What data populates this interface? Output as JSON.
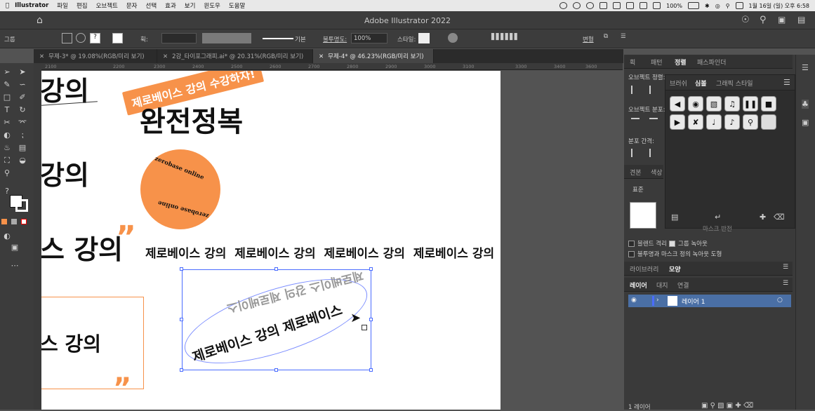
{
  "menubar": {
    "app": "Illustrator",
    "items": [
      "파일",
      "편집",
      "오브젝트",
      "문자",
      "선택",
      "효과",
      "보기",
      "윈도우",
      "도움말"
    ],
    "battery": "100%",
    "clock": "1월 16일 (일) 오후 6:58"
  },
  "titlebar": {
    "title": "Adobe Illustrator 2022"
  },
  "controlbar": {
    "group_label": "그룹",
    "stroke_label": "획:",
    "stroke_style": "기본",
    "opacity_label": "불투명도:",
    "opacity_value": "100%",
    "style_label": "스타일:",
    "transform_label": "변형"
  },
  "doc_tabs": [
    {
      "label": "무제-3* @ 19.08%(RGB/미리 보기)",
      "active": false
    },
    {
      "label": "2강_타이포그래피.ai* @ 20.31%(RGB/미리 보기)",
      "active": false
    },
    {
      "label": "무제-4* @ 46.23%(RGB/미리 보기)",
      "active": true
    }
  ],
  "ruler_ticks": [
    "2100",
    "2200",
    "2300",
    "2400",
    "2500",
    "2600",
    "2700",
    "2800",
    "2900",
    "3000",
    "3100",
    "3200",
    "3300",
    "3400",
    "3500",
    "3600"
  ],
  "canvas": {
    "line1": "강의",
    "banner": "제로베이스 강의 수강하자!",
    "headline": "완전정복",
    "line2": "강의",
    "badge_top": "zerobase online",
    "badge_bottom": "zerobase online",
    "line3": "스 강의",
    "quote_mark": "”",
    "repeat_text": "제로베이스 강의  제로베이스 강의  제로베이스 강의  제로베이스 강의",
    "box_text": "스 강의",
    "box_quote": "”",
    "ring_front": "제로베이스 강의 제로베이스",
    "ring_back": "제로베이스 강의 제로베이스"
  },
  "right_panel": {
    "top_tabs": [
      "획",
      "패턴",
      "정렬",
      "패스파인더"
    ],
    "active_top_tab": "정렬",
    "align_objects_label": "오브젝트 정렬:",
    "distribute_objects_label": "오브젝트 분포:",
    "distribute_spacing_label": "분포 간격:",
    "symbol_tabs": [
      "브러쉬",
      "심볼",
      "그래픽 스타일"
    ],
    "active_symbol_tab": "심볼",
    "swatch_tabs": [
      "견본",
      "색상"
    ],
    "swatch_label": "표준",
    "blend_isolate": "블렌드 격리",
    "knockout_group": "그룹 녹아웃",
    "opacity_mask_label": "불투명과 마스크 정의 녹아웃 도형",
    "clip_label": "마스크 반전",
    "library_tabs": [
      "라이브러리",
      "모양"
    ],
    "active_library_tab": "모양",
    "layer_tabs": [
      "레이어",
      "대지",
      "연결"
    ],
    "active_layer_tab": "레이어",
    "layer_name": "레이어 1",
    "layer_count": "1 레이어"
  },
  "colors": {
    "orange": "#f7924a",
    "selection": "#4a6cff",
    "panel_bg": "#3a3a3a",
    "layer_highlight": "#4a6fa5"
  }
}
